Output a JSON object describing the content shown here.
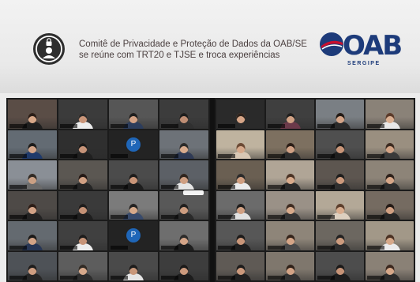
{
  "headline": {
    "line1": "Comitê de Privacidade e Proteção de Dados da OAB/SE",
    "line2": "se reúne com TRT20 e TJSE e troca experiências"
  },
  "logo": {
    "text": "OAB",
    "sub": "SERGIPE"
  },
  "colors": {
    "headline": "#4a3f3f",
    "brand_blue": "#1d3b7a",
    "brand_red": "#c8102e",
    "avatar_blue": "#1f66b8",
    "badge": "#2e2e2e"
  },
  "icons": [
    "lock-icon",
    "user-icon",
    "globe-icon"
  ],
  "call": {
    "left_screen": {
      "tiles": [
        {
          "kind": "video",
          "room": "#5a4d46",
          "skin": "#d7a788",
          "shirt": "#1f1f1f",
          "hair": "#2a1d17"
        },
        {
          "kind": "video",
          "room": "#3b3b3b",
          "skin": "#c99579",
          "shirt": "#ededed",
          "hair": "#2b2b2b"
        },
        {
          "kind": "video",
          "room": "#565656",
          "skin": "#d3a285",
          "shirt": "#2c3d5c",
          "hair": "#1e1e1e"
        },
        {
          "kind": "video",
          "room": "#3c3c3c",
          "skin": "#bf8e74",
          "shirt": "#303030",
          "hair": "#1d1d1d"
        },
        {
          "kind": "video",
          "room": "#636b73",
          "skin": "#d3a488",
          "shirt": "#1f3a6b",
          "hair": "#1b1b1b"
        },
        {
          "kind": "video",
          "room": "#2f2f2f",
          "skin": "#c69378",
          "shirt": "#202020",
          "hair": "#1a1a1a"
        },
        {
          "kind": "avatar",
          "letter": "P"
        },
        {
          "kind": "video",
          "room": "#6d7278",
          "skin": "#d8ab8d",
          "shirt": "#2f3a55",
          "hair": "#2a2a2a"
        },
        {
          "kind": "video",
          "room": "#8a8f96",
          "skin": "#caa084",
          "shirt": "#6a6a6a",
          "hair": "#302a25"
        },
        {
          "kind": "video",
          "room": "#5b5752",
          "skin": "#d0a083",
          "shirt": "#262626",
          "hair": "#221815"
        },
        {
          "kind": "video",
          "room": "#4b4b4b",
          "skin": "#c99578",
          "shirt": "#1e1e1e",
          "hair": "#1b1b1b"
        },
        {
          "kind": "video",
          "room": "#5c6066",
          "skin": "#cf9f82",
          "shirt": "#e6e6e6",
          "hair": "#2d241e"
        },
        {
          "kind": "video",
          "room": "#4e4a47",
          "skin": "#d1a286",
          "shirt": "#222222",
          "hair": "#2a1c16"
        },
        {
          "kind": "video",
          "room": "#3a3a3a",
          "skin": "#c59276",
          "shirt": "#1f1f1f",
          "hair": "#1c1c1c"
        },
        {
          "kind": "video",
          "room": "#7b7b7b",
          "skin": "#d6a98a",
          "shirt": "#384a6b",
          "hair": "#212121"
        },
        {
          "kind": "video",
          "room": "#585858",
          "skin": "#cc9c7f",
          "shirt": "#2a2a2a",
          "hair": "#1e1e1e"
        },
        {
          "kind": "video",
          "room": "#646a70",
          "skin": "#d2a386",
          "shirt": "#273655",
          "hair": "#191919"
        },
        {
          "kind": "video",
          "room": "#404040",
          "skin": "#c79478",
          "shirt": "#ededed",
          "hair": "#1c1c1c"
        },
        {
          "kind": "avatar",
          "letter": "P"
        },
        {
          "kind": "video",
          "room": "#6e6e6e",
          "skin": "#d4a588",
          "shirt": "#1f1f1f",
          "hair": "#2b2b2b"
        },
        {
          "kind": "video",
          "room": "#4e5257",
          "skin": "#cf9e81",
          "shirt": "#262626",
          "hair": "#1d1d1d"
        },
        {
          "kind": "video",
          "room": "#5d5d5d",
          "skin": "#d6a98b",
          "shirt": "#2d2d2d",
          "hair": "#2f2a25"
        },
        {
          "kind": "video",
          "room": "#4a4a4a",
          "skin": "#c8977a",
          "shirt": "#e5e5e5",
          "hair": "#1c1c1c"
        },
        {
          "kind": "video",
          "room": "#3d3d3d",
          "skin": "#cc9a7d",
          "shirt": "#1d1d1d",
          "hair": "#1a1a1a"
        }
      ]
    },
    "right_screen": {
      "tiles": [
        {
          "kind": "video",
          "room": "#2a2a2a",
          "skin": "#d6a587",
          "shirt": "#2a2a2a",
          "hair": "#2d221c"
        },
        {
          "kind": "video",
          "room": "#3f3f3f",
          "skin": "#d0a184",
          "shirt": "#6b3a4a",
          "hair": "#1f1f1f"
        },
        {
          "kind": "video",
          "room": "#7a7f84",
          "skin": "#d4a487",
          "shirt": "#2a2a2a",
          "hair": "#211a16"
        },
        {
          "kind": "video",
          "room": "#8a8278",
          "skin": "#d9ae90",
          "shirt": "#e8e8e8",
          "hair": "#5a3a2a"
        },
        {
          "kind": "video",
          "room": "#bfb39f",
          "skin": "#d6a98b",
          "shirt": "#d9c8b5",
          "hair": "#6b4a35"
        },
        {
          "kind": "video",
          "room": "#7d7060",
          "skin": "#cfa084",
          "shirt": "#2c2c2c",
          "hair": "#2a1d16"
        },
        {
          "kind": "video",
          "room": "#4f4f4f",
          "skin": "#c89578",
          "shirt": "#1f1f1f",
          "hair": "#1b1b1b"
        },
        {
          "kind": "video",
          "room": "#9a8f80",
          "skin": "#d2a385",
          "shirt": "#3a3a3a",
          "hair": "#3b2a20"
        },
        {
          "kind": "video",
          "room": "#6a5f52",
          "skin": "#cf9e80",
          "shirt": "#ececec",
          "hair": "#2a2a2a"
        },
        {
          "kind": "video",
          "room": "#b0a596",
          "skin": "#d8ab8c",
          "shirt": "#2b2b2b",
          "hair": "#4a3325"
        },
        {
          "kind": "video",
          "room": "#5d5650",
          "skin": "#cb997c",
          "shirt": "#2f2f2f",
          "hair": "#1d1d1d"
        },
        {
          "kind": "video",
          "room": "#8d8478",
          "skin": "#d5a688",
          "shirt": "#2d2d2d",
          "hair": "#2b201a"
        },
        {
          "kind": "video",
          "room": "#6b6b6b",
          "skin": "#d0a083",
          "shirt": "#e2e2e2",
          "hair": "#1c1c1c"
        },
        {
          "kind": "video",
          "room": "#9a9187",
          "skin": "#d7aa8b",
          "shirt": "#353535",
          "hair": "#3d2b21"
        },
        {
          "kind": "video",
          "room": "#b3a897",
          "skin": "#d9ad8e",
          "shirt": "#ddd0c0",
          "hair": "#5b3e2c"
        },
        {
          "kind": "video",
          "room": "#756b61",
          "skin": "#cf9f82",
          "shirt": "#262626",
          "hair": "#221915"
        },
        {
          "kind": "video",
          "room": "#575757",
          "skin": "#c99679",
          "shirt": "#1f1f1f",
          "hair": "#1b1b1b"
        },
        {
          "kind": "video",
          "room": "#8e8579",
          "skin": "#d4a587",
          "shirt": "#4a4a4a",
          "hair": "#33241b"
        },
        {
          "kind": "video",
          "room": "#6c6760",
          "skin": "#cc9b7e",
          "shirt": "#2e2e2e",
          "hair": "#222222"
        },
        {
          "kind": "video",
          "room": "#a29888",
          "skin": "#d6a98a",
          "shirt": "#ebebeb",
          "hair": "#4a3224"
        },
        {
          "kind": "video",
          "room": "#5f5a55",
          "skin": "#cb997c",
          "shirt": "#202020",
          "hair": "#1c1c1c"
        },
        {
          "kind": "video",
          "room": "#7f776d",
          "skin": "#d2a386",
          "shirt": "#323232",
          "hair": "#2e2119"
        },
        {
          "kind": "video",
          "room": "#4d4d4d",
          "skin": "#c69377",
          "shirt": "#1d1d1d",
          "hair": "#1a1a1a"
        },
        {
          "kind": "video",
          "room": "#8a8176",
          "skin": "#d5a789",
          "shirt": "#2b2b2b",
          "hair": "#3a281f"
        }
      ]
    }
  }
}
